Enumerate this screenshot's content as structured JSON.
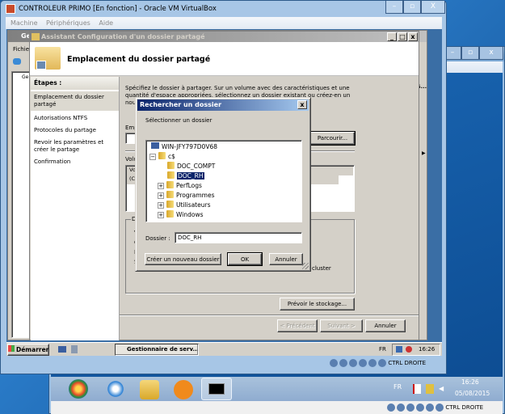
{
  "vbox_front": {
    "title": "CONTROLEUR PRIMO [En fonction] - Oracle VM VirtualBox",
    "menu": [
      "Machine",
      "Périphériques",
      "Aide"
    ],
    "host_key": "CTRL DROITE"
  },
  "vbox_back": {
    "host_key": "CTRL DROITE"
  },
  "server_manager": {
    "title_short": "Ge",
    "menu_short": "Fichie",
    "tree_root": "Ge",
    "column_short": "S..."
  },
  "wizard": {
    "title": "Assistant Configuration d'un dossier partagé",
    "header": "Emplacement du dossier partagé",
    "steps_title": "Étapes :",
    "steps": [
      "Emplacement du dossier partagé",
      "Autorisations NTFS",
      "Protocoles du partage",
      "Revoir les paramètres et créer le partage",
      "Confirmation"
    ],
    "description": "Spécifiez le dossier à partager. Sur un volume avec des caractéristiques et une quantité d'espace appropriées, sélectionnez un dossier existant ou créez-en un nouveau. S'il n'existe pas, créez-en un.",
    "location_label_short": "Emp",
    "browse": "Parcourir...",
    "volumes_label_short": "Volu",
    "col_short": "Vo",
    "row_short": "(C",
    "group_short": "D",
    "group_lines_short": [
      "V",
      "C",
      "I",
      "S"
    ],
    "cluster_text": "cluster",
    "plan_storage": "Prévoir le stockage...",
    "prev": "< Précédent",
    "next": "Suivant >",
    "cancel": "Annuler"
  },
  "dialog": {
    "title": "Rechercher un dossier",
    "prompt": "Sélectionner un dossier",
    "tree": {
      "computer": "WIN-JFY797D0V68",
      "drive": "c$",
      "folders": [
        {
          "name": "DOC_COMPT",
          "expandable": false,
          "selected": false
        },
        {
          "name": "DOC_RH",
          "expandable": false,
          "selected": true
        },
        {
          "name": "PerfLogs",
          "expandable": true,
          "selected": false
        },
        {
          "name": "Programmes",
          "expandable": true,
          "selected": false
        },
        {
          "name": "Utilisateurs",
          "expandable": true,
          "selected": false
        },
        {
          "name": "Windows",
          "expandable": true,
          "selected": false
        }
      ]
    },
    "folder_label": "Dossier :",
    "folder_value": "DOC_RH",
    "new_folder": "Créer un nouveau dossier",
    "ok": "OK",
    "cancel": "Annuler"
  },
  "guest_taskbar": {
    "start": "Démarrer",
    "task": "Gestionnaire de serv...",
    "lang": "FR",
    "time": "16:26"
  },
  "host_taskbar": {
    "lang": "FR",
    "time": "16:26",
    "date": "05/08/2015"
  },
  "colors": {
    "selection": "#0a246a",
    "title_active": "#0a246a",
    "title_inactive": "#808080",
    "classic": "#d4d0c8"
  }
}
